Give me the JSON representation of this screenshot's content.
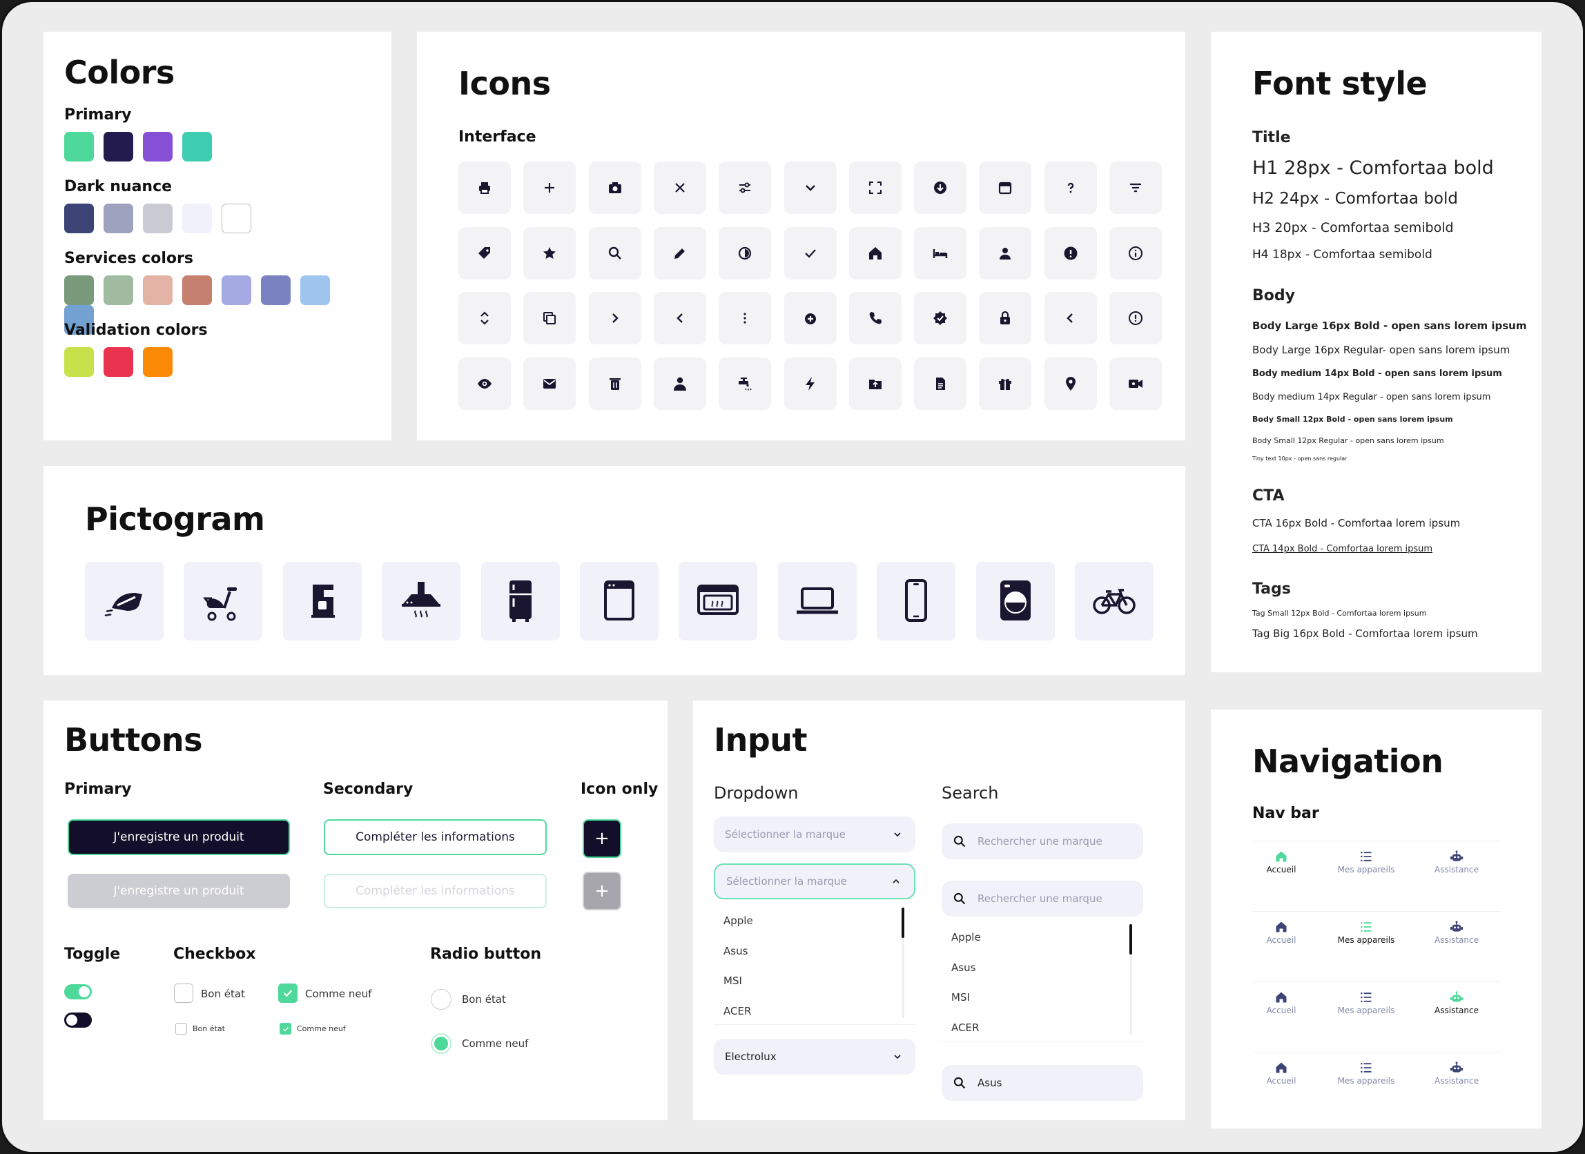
{
  "colors": {
    "title": "Colors",
    "groups": [
      {
        "label": "Primary",
        "swatches": [
          "#4ed99a",
          "#231a4d",
          "#8650d6",
          "#3ecdb0"
        ]
      },
      {
        "label": "Dark nuance",
        "swatches": [
          "#3c4475",
          "#9ea2be",
          "#c9cad4",
          "#f1f1fb",
          "#ffffff"
        ]
      },
      {
        "label": "Services colors",
        "swatches": [
          "#7a9a7c",
          "#a0bba0",
          "#e3b4a6",
          "#c58070",
          "#a5abe2",
          "#7b82c2",
          "#9fc4ee",
          "#73a2d2"
        ]
      },
      {
        "label": "Validation colors",
        "swatches": [
          "#c6e14a",
          "#e9334f",
          "#fb8a07"
        ]
      }
    ]
  },
  "icons": {
    "title": "Icons",
    "subtitle": "Interface",
    "names": [
      "printer-icon",
      "plus-icon",
      "camera-icon",
      "close-icon",
      "sliders-icon",
      "chevron-down-icon",
      "expand-icon",
      "download-circle-icon",
      "calendar-icon",
      "help-icon",
      "filter-icon",
      "tag-icon",
      "star-icon",
      "search-icon",
      "pencil-icon",
      "timer-icon",
      "check-icon",
      "home-icon",
      "bed-icon",
      "user-icon",
      "alert-circle-icon",
      "info-circle-icon",
      "sort-icon",
      "copy-icon",
      "chevron-right-icon",
      "chevron-left-icon",
      "more-vertical-icon",
      "add-circle-icon",
      "phone-icon",
      "badge-check-icon",
      "lock-icon",
      "back-icon",
      "clock-icon",
      "eye-icon",
      "mail-icon",
      "trash-icon",
      "person-icon",
      "faucet-icon",
      "bolt-icon",
      "folder-upload-icon",
      "document-icon",
      "gift-icon",
      "location-pin-icon",
      "video-camera-icon"
    ]
  },
  "pictogram": {
    "title": "Pictogram",
    "names": [
      "iron-pictogram",
      "exercise-bike-pictogram",
      "coffee-machine-pictogram",
      "range-hood-pictogram",
      "fridge-pictogram",
      "dishwasher-pictogram",
      "oven-pictogram",
      "laptop-pictogram",
      "smartphone-pictogram",
      "washing-machine-pictogram",
      "bicycle-pictogram"
    ]
  },
  "font": {
    "title": "Font style",
    "sections": [
      {
        "label": "Title",
        "samples": [
          "H1 28px - Comfortaa bold",
          "H2 24px - Comfortaa bold",
          "H3 20px - Comfortaa semibold",
          "H4 18px - Comfortaa semibold"
        ]
      },
      {
        "label": "Body",
        "samples": [
          "Body Large 16px Bold - open sans lorem ipsum",
          "Body Large 16px Regular- open sans lorem ipsum",
          "Body medium 14px Bold - open sans lorem ipsum",
          "Body medium 14px Regular - open sans lorem ipsum",
          "Body Small 12px Bold - open sans lorem ipsum",
          "Body Small 12px Regular - open sans lorem ipsum",
          "Tiny text 10px - open sans regular"
        ]
      },
      {
        "label": "CTA",
        "samples": [
          "CTA 16px Bold - Comfortaa lorem ipsum",
          "CTA 14px Bold - Comfortaa lorem ipsum"
        ]
      },
      {
        "label": "Tags",
        "samples": [
          "Tag Small 12px Bold - Comfortaa lorem ipsum",
          "Tag Big 16px Bold - Comfortaa lorem ipsum"
        ]
      }
    ]
  },
  "buttons": {
    "title": "Buttons",
    "primary_label": "Primary",
    "secondary_label": "Secondary",
    "icon_only_label": "Icon only",
    "primary_text": "J'enregistre un produit",
    "secondary_text": "Compléter les informations",
    "icon_symbol": "+",
    "toggle_label": "Toggle",
    "checkbox_label": "Checkbox",
    "radio_label": "Radio button",
    "opt_good": "Bon état",
    "opt_new": "Comme neuf"
  },
  "input": {
    "title": "Input",
    "dropdown_label": "Dropdown",
    "search_label": "Search",
    "dropdown_placeholder": "Sélectionner la marque",
    "search_placeholder": "Rechercher une marque",
    "options": [
      "Apple",
      "Asus",
      "MSI",
      "ACER"
    ],
    "dropdown_value": "Electrolux",
    "search_value": "Asus"
  },
  "navigation": {
    "title": "Navigation",
    "subtitle": "Nav bar",
    "items": [
      "Accueil",
      "Mes appareils",
      "Assistance"
    ],
    "active_color": "#4ed99a"
  }
}
